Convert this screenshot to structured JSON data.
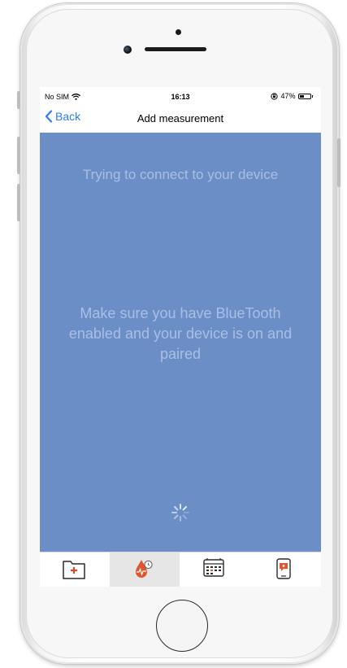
{
  "status_bar": {
    "carrier": "No SIM",
    "time": "16:13",
    "battery_percent": "47%",
    "battery_level": 0.47
  },
  "nav": {
    "back_label": "Back",
    "title": "Add measurement"
  },
  "main": {
    "connect_message": "Trying to connect to your device",
    "bluetooth_message": "Make sure you have BlueTooth enabled and your device is on and paired"
  },
  "tabs": [
    {
      "icon": "medical-folder-icon",
      "selected": false
    },
    {
      "icon": "blood-drop-clock-icon",
      "selected": true
    },
    {
      "icon": "calendar-icon",
      "selected": false
    },
    {
      "icon": "phone-chat-icon",
      "selected": false
    }
  ],
  "colors": {
    "content_background": "#6b8ec7",
    "message_text": "#a9bfe3",
    "accent_blue": "#2f7cf6",
    "tab_icon_red": "#d94a2b",
    "tab_icon_orange": "#e0562f"
  }
}
